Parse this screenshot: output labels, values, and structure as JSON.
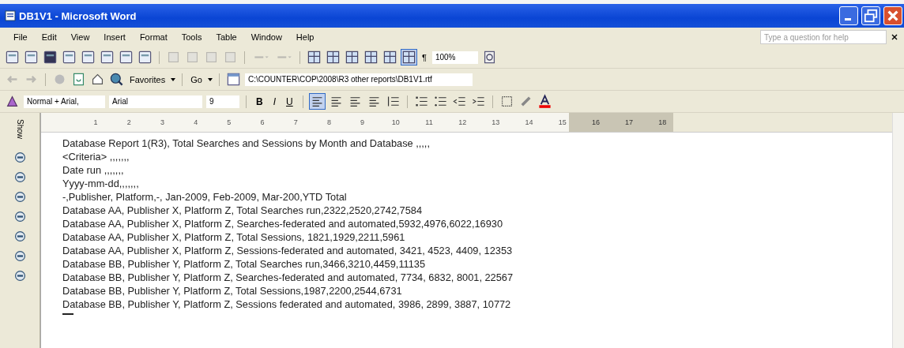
{
  "window": {
    "title": "DB1V1 - Microsoft Word"
  },
  "menu": [
    {
      "label": "File"
    },
    {
      "label": "Edit"
    },
    {
      "label": "View"
    },
    {
      "label": "Insert"
    },
    {
      "label": "Format"
    },
    {
      "label": "Tools"
    },
    {
      "label": "Table"
    },
    {
      "label": "Window"
    },
    {
      "label": "Help"
    }
  ],
  "help_box": {
    "placeholder": "Type a question for help"
  },
  "standard_toolbar": {
    "zoom": "100%",
    "show_hide_mark": "¶"
  },
  "web_toolbar": {
    "favorites": "Favorites",
    "go": "Go",
    "address": "C:\\COUNTER\\COP\\2008\\R3 other reports\\DB1V1.rtf"
  },
  "formatting_toolbar": {
    "style": "Normal + Arial,",
    "font": "Arial",
    "size": "9",
    "bold": "B",
    "italic": "I",
    "underline": "U"
  },
  "reviewing_toolbar": {
    "show": "Show"
  },
  "ruler": {
    "marks": [
      "1",
      "2",
      "3",
      "4",
      "5",
      "6",
      "7",
      "8",
      "9",
      "10",
      "11",
      "12",
      "13",
      "14",
      "15",
      "16",
      "17",
      "18"
    ]
  },
  "document": {
    "lines": [
      "Database Report 1(R3), Total Searches and Sessions by Month and Database ,,,,,",
      "<Criteria> ,,,,,,,",
      "Date run ,,,,,,,",
      "Yyyy-mm-dd,,,,,,,",
      "-,Publisher, Platform,-, Jan-2009, Feb-2009, Mar-200,YTD Total",
      "Database AA, Publisher X, Platform Z, Total Searches run,2322,2520,2742,7584",
      "Database AA, Publisher X, Platform Z, Searches-federated and automated,5932,4976,6022,16930",
      "Database AA, Publisher X, Platform Z, Total Sessions, 1821,1929,2211,5961",
      "Database AA, Publisher X, Platform Z, Sessions-federated and automated, 3421, 4523, 4409, 12353",
      "Database BB, Publisher Y, Platform Z, Total Searches run,3466,3210,4459,11135",
      "Database BB, Publisher Y, Platform Z, Searches-federated and automated, 7734, 6832, 8001, 22567",
      "Database BB, Publisher Y, Platform Z, Total Sessions,1987,2200,2544,6731",
      "Database BB, Publisher Y, Platform Z, Sessions federated and automated, 3986, 2899, 3887, 10772"
    ]
  }
}
